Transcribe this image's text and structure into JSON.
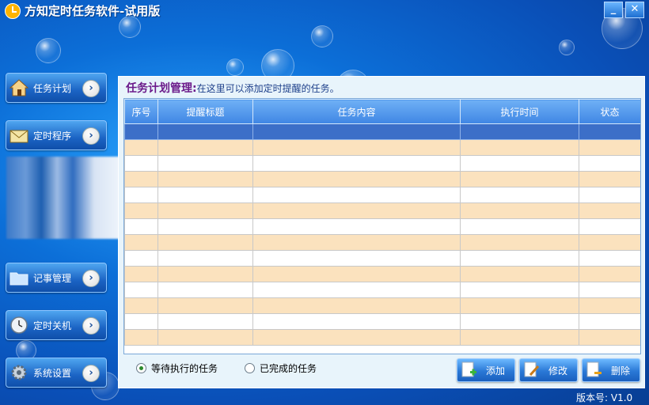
{
  "window": {
    "title": "方知定时任务软件-试用版",
    "minimize": "_",
    "close": "✕"
  },
  "sidebar": {
    "items": [
      {
        "label": "任务计划",
        "icon": "house-icon"
      },
      {
        "label": "定时程序",
        "icon": "envelope-icon"
      },
      {
        "label": "记事管理",
        "icon": "folder-icon"
      },
      {
        "label": "定时关机",
        "icon": "clock-icon"
      },
      {
        "label": "系统设置",
        "icon": "gear-icon"
      }
    ]
  },
  "main": {
    "title": "任务计划管理:",
    "subtitle": "在这里可以添加定时提醒的任务。",
    "table": {
      "columns": [
        "序号",
        "提醒标题",
        "任务内容",
        "执行时间",
        "状态"
      ],
      "row_count": 14,
      "selected_row": 0
    },
    "filters": [
      {
        "label": "等待执行的任务",
        "checked": true
      },
      {
        "label": "已完成的任务",
        "checked": false
      }
    ],
    "actions": {
      "add": "添加",
      "edit": "修改",
      "delete": "删除"
    }
  },
  "status": {
    "version": "版本号: V1.0"
  },
  "colors": {
    "selected_row": "#3c6fc8",
    "odd_row": "#fbe2be",
    "header": "#4f94ea",
    "title_accent": "#6b1a8a"
  }
}
